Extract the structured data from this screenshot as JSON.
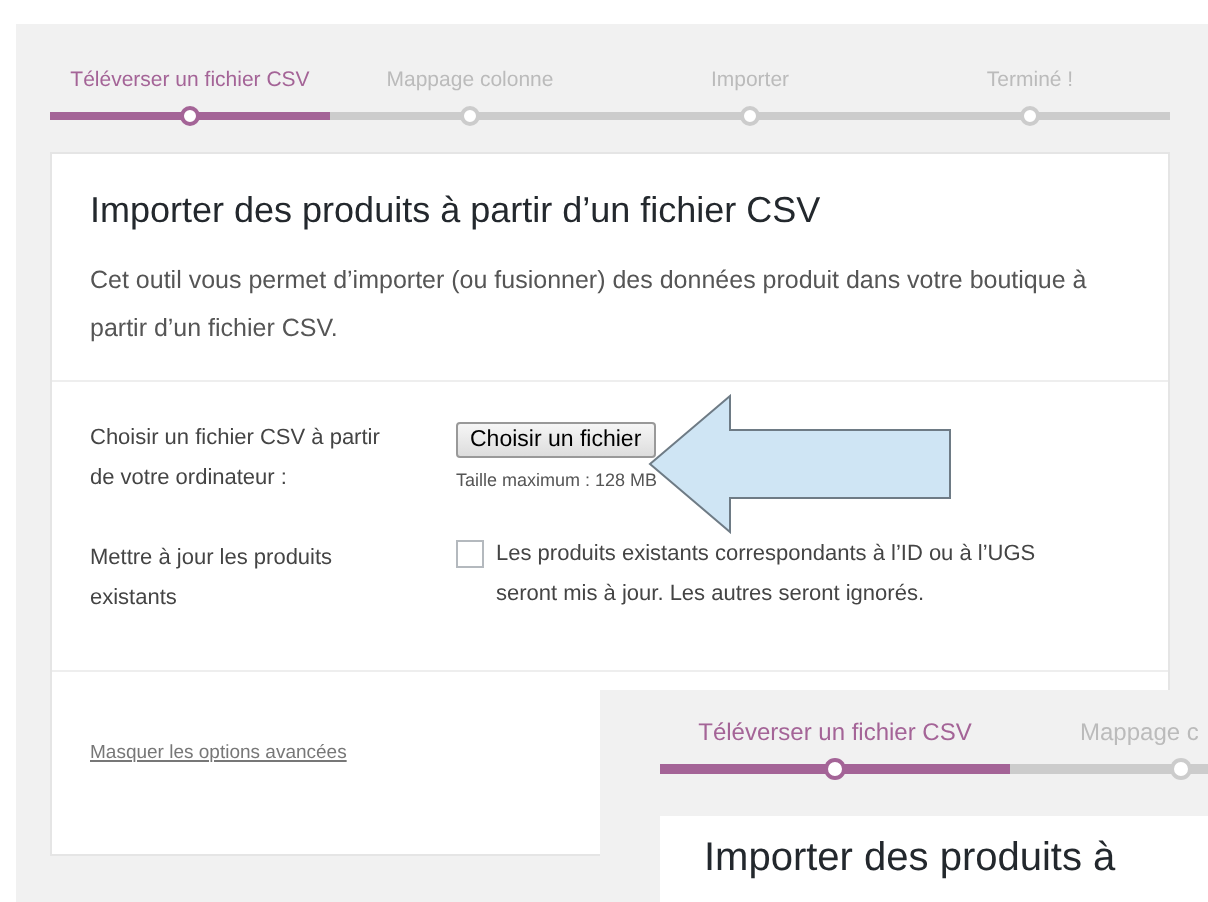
{
  "steps": [
    {
      "label": "Téléverser un fichier CSV",
      "selected": true
    },
    {
      "label": "Mappage colonne",
      "selected": false
    },
    {
      "label": "Importer",
      "selected": false
    },
    {
      "label": "Terminé !",
      "selected": false
    }
  ],
  "card": {
    "title": "Importer des produits à partir d’un fichier CSV",
    "description": "Cet outil vous permet d’importer (ou fusionner) des données produit dans votre boutique à partir d’un fichier CSV.",
    "file_row": {
      "label": "Choisir un fichier CSV à partir de votre ordinateur :",
      "button": "Choisir un fichier",
      "hint": "Taille maximum : 128 MB"
    },
    "update_row": {
      "label": "Mettre à jour les produits existants",
      "checked": false,
      "text": "Les produits existants correspondants à l’ID ou à l’UGS seront mis à jour. Les autres seront ignorés."
    },
    "advanced_link": "Masquer les options avancées"
  },
  "inset": {
    "steps": [
      {
        "label": "Téléverser un fichier CSV",
        "selected": true
      },
      {
        "label": "Mappage c",
        "selected": false
      }
    ],
    "title": "Importer des produits à"
  }
}
